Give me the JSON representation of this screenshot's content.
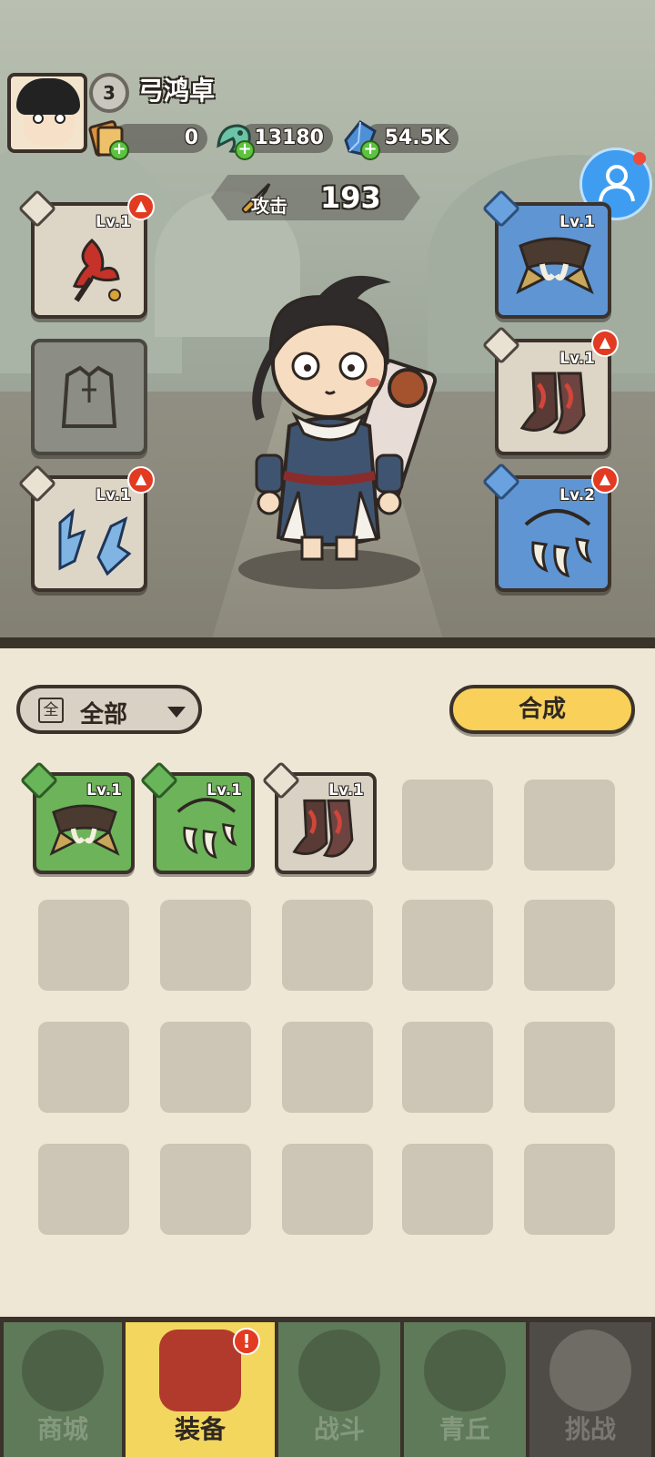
{
  "player": {
    "name": "弓鸿卓",
    "level": "3"
  },
  "currencies": [
    {
      "icon": "scroll-ticket-icon",
      "value": "0"
    },
    {
      "icon": "jade-dragon-icon",
      "value": "13180"
    },
    {
      "icon": "blue-crystal-icon",
      "value": "54.5K"
    }
  ],
  "stats": {
    "attack_label": "攻击",
    "attack_value": "193"
  },
  "equipment": {
    "weapon": {
      "icon": "red-flower-fan-icon",
      "type_icon": "sword-icon",
      "level": "Lv.1",
      "upgrade": true
    },
    "armor": {
      "icon": "robe-outline-icon",
      "empty": true
    },
    "accessory": {
      "icon": "ice-claw-icon",
      "type_icon": "ring-icon",
      "level": "Lv.1",
      "upgrade": true
    },
    "shoulder": {
      "icon": "fang-shoulder-icon",
      "type_icon": "shoulder-icon",
      "level": "Lv.1",
      "upgrade": false
    },
    "boots": {
      "icon": "red-boots-icon",
      "type_icon": "boot-icon",
      "level": "Lv.1",
      "upgrade": true
    },
    "necklace": {
      "icon": "fang-necklace-icon",
      "type_icon": "necklace-icon",
      "level": "Lv.2",
      "upgrade": true
    }
  },
  "inventory": {
    "filter_icon": "全",
    "filter_label": "全部",
    "synth_label": "合成",
    "items": [
      {
        "icon": "fang-shoulder-icon",
        "level": "Lv.1"
      },
      {
        "icon": "fang-necklace-icon",
        "level": "Lv.1"
      },
      {
        "icon": "red-boots-icon",
        "level": "Lv.1"
      }
    ]
  },
  "nav": {
    "tabs": [
      {
        "label": "商城",
        "icon": "shop-pagoda-icon"
      },
      {
        "label": "装备",
        "icon": "equipment-helmet-icon",
        "alert": "!"
      },
      {
        "label": "战斗",
        "icon": "crossed-swords-icon"
      },
      {
        "label": "青丘",
        "icon": "mountain-icon"
      },
      {
        "label": "挑战",
        "icon": "challenge-orb-icon"
      }
    ]
  },
  "colors": {
    "rare_blue": "#5f95d3",
    "uncommon_green": "#6db35a",
    "accent_yellow": "#f8d05a",
    "alert_red": "#e23b22"
  }
}
